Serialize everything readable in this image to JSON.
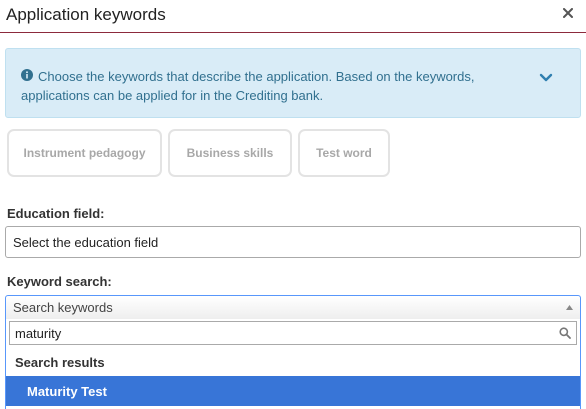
{
  "dialog": {
    "title": "Application keywords",
    "close_icon": "close-icon"
  },
  "info": {
    "icon": "info-circle-icon",
    "text": "Choose the keywords that describe the application. Based on the keywords, applications can be applied for in the Crediting bank.",
    "toggle_icon": "chevron-down-icon",
    "color": "#31708f",
    "background": "#d9ecf7"
  },
  "keywords": [
    {
      "label": "Instrument pedagogy"
    },
    {
      "label": "Business skills"
    },
    {
      "label": "Test word"
    }
  ],
  "education_field": {
    "label": "Education field:",
    "value": "Select the education field"
  },
  "keyword_search": {
    "label": "Keyword search:",
    "placeholder": "Search keywords",
    "search_value": "maturity",
    "search_icon": "magnifier-icon",
    "group_label": "Search results",
    "results": [
      {
        "label": "Maturity Test",
        "highlighted": true
      }
    ],
    "highlight_color": "#3875d7"
  },
  "accent_color": "#8c2a3c"
}
